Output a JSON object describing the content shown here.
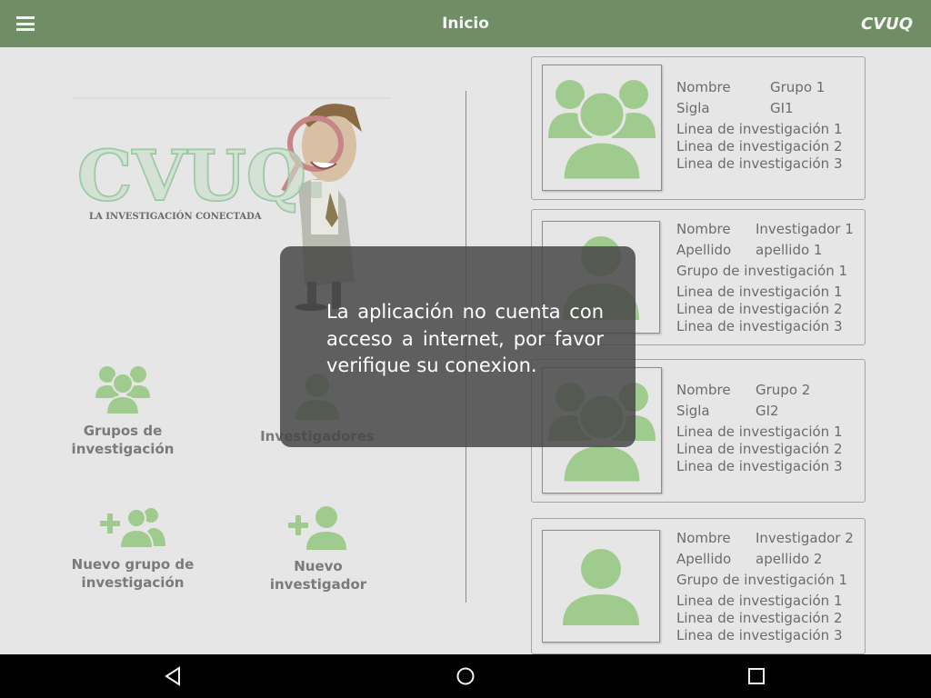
{
  "appbar": {
    "title": "Inicio",
    "brand": "CVUQ",
    "menu_icon": "hamburger-menu-icon"
  },
  "logo": {
    "title": "CVUQ",
    "tagline": "LA INVESTIGACIÓN CONECTADA"
  },
  "tiles": {
    "groups": {
      "label": "Grupos de investigación",
      "icon": "people-group-icon"
    },
    "researchers": {
      "label": "Investigadores",
      "icon": "person-icon"
    },
    "new_group": {
      "label": "Nuevo grupo de investigación",
      "icon": "add-group-icon"
    },
    "new_researcher": {
      "label": "Nuevo investigador",
      "icon": "add-person-icon"
    }
  },
  "cards": [
    {
      "type": "group",
      "fields": [
        {
          "key": "Nombre",
          "value": "Grupo 1"
        },
        {
          "key": "Sigla",
          "value": "GI1"
        }
      ],
      "lines": [
        "Linea de investigación 1",
        "Linea de investigación 2",
        "Linea de investigación 3"
      ]
    },
    {
      "type": "researcher",
      "fields": [
        {
          "key": "Nombre",
          "value": "Investigador 1"
        },
        {
          "key": "Apellido",
          "value": "apellido 1"
        }
      ],
      "group": "Grupo de investigación 1",
      "lines": [
        "Linea de investigación 1",
        "Linea de investigación 2",
        "Linea de investigación 3"
      ]
    },
    {
      "type": "group",
      "fields": [
        {
          "key": "Nombre",
          "value": "Grupo 2"
        },
        {
          "key": "Sigla",
          "value": "GI2"
        }
      ],
      "lines": [
        "Linea de investigación 1",
        "Linea de investigación 2",
        "Linea de investigación 3"
      ]
    },
    {
      "type": "researcher",
      "fields": [
        {
          "key": "Nombre",
          "value": "Investigador 2"
        },
        {
          "key": "Apellido",
          "value": "apellido 2"
        }
      ],
      "group": "Grupo de investigación 1",
      "lines": [
        "Linea de investigación 1",
        "Linea de investigación 2",
        "Linea de investigación 3"
      ]
    }
  ],
  "toast": {
    "message": "La aplicación no cuenta con acceso a internet, por favor verifique su conexion."
  },
  "navbar": {
    "back_icon": "back-triangle-icon",
    "home_icon": "home-circle-icon",
    "recents_icon": "recents-square-icon"
  },
  "colors": {
    "appbar": "#6f8e65",
    "icon_green": "#9fcb8f",
    "background": "#e6e6e6"
  }
}
